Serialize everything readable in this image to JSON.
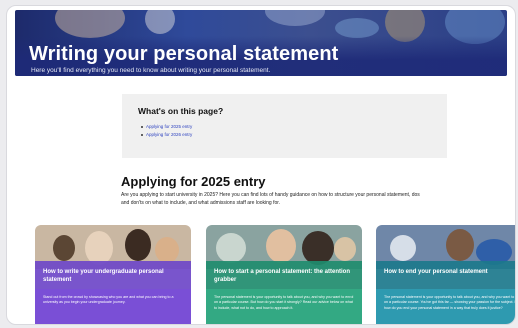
{
  "hero": {
    "title": "Writing your personal statement",
    "subtitle": "Here you'll find everything you need to know about writing your personal statement."
  },
  "toc": {
    "title": "What's on this page?",
    "items": [
      "Applying for 2025 entry",
      "Applying for 2026 entry"
    ]
  },
  "section": {
    "title": "Applying for 2025 entry",
    "text": "Are you applying to start university in 2025? Here you can find lots of handy guidance on how to structure your personal statement, dos and don'ts on what to include, and what admissions staff are looking for."
  },
  "cards": [
    {
      "title": "How to write your undergraduate personal statement",
      "text": "Stand out from the crowd by showcasing who you are and what you can bring to a university as you begin your undergraduate journey.",
      "color": "#7a4fd6"
    },
    {
      "title": "How to start a personal statement: the attention grabber",
      "text": "The personal statement is your opportunity to talk about you, and why you want to enrol on a particular course. But how do you start it strongly? Read our advice below on what to include, what not to do, and how to approach it.",
      "color": "#33a983"
    },
    {
      "title": "How to end your personal statement",
      "text": "The personal statement is your opportunity to talk about you, and why you want to enrol on a particular course. You've got this far — showing your passion for the subject. But how do you end your personal statement in a way that truly does it justice?",
      "color": "#2e9ab0"
    }
  ]
}
